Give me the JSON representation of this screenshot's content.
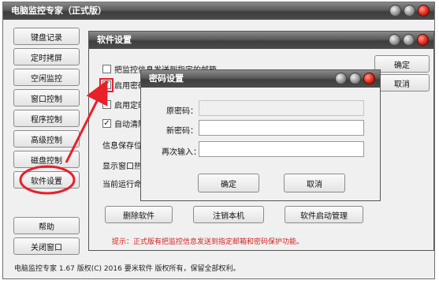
{
  "main_window": {
    "title": "电脑监控专家（正式版）",
    "menu": [
      "键盘记录",
      "定时拷屏",
      "空闲监控",
      "窗口控制",
      "程序控制",
      "高级控制",
      "磁盘控制",
      "软件设置"
    ],
    "help_label": "帮助",
    "close_label": "关闭窗口",
    "status_text": "电脑监控专家 1.67 版权(C) 2016 要米软件 版权所有，保留全部权利。"
  },
  "settings_window": {
    "title": "软件设置",
    "options": [
      {
        "label": "把监控信息发送到指定的邮箱",
        "checked": false
      },
      {
        "label": "启用密码",
        "checked": true
      },
      {
        "label": "启用定时",
        "checked": false
      },
      {
        "label": "自动清除",
        "checked": true
      }
    ],
    "info_save_label": "信息保存位置",
    "hotkey_label": "显示窗口热键",
    "current_label": "当前运行命令",
    "ok_label": "确定",
    "cancel_label": "取消",
    "uninstall_label": "删除软件",
    "logout_label": "注销本机",
    "startup_label": "软件启动管理",
    "hint_text": "提示：正式版有把监控信息发送到指定邮箱和密码保护功能。"
  },
  "password_dialog": {
    "title": "密码设置",
    "old_password_label": "原密码：",
    "new_password_label": "新密码：",
    "confirm_label": "再次输入：",
    "old_password_value": "",
    "new_password_value": "",
    "confirm_value": "",
    "ok_label": "确定",
    "cancel_label": "取消"
  },
  "colors": {
    "titlebar": "#4c4c4c",
    "window_bg": "#f0f0f0",
    "highlight": "#e8202a",
    "hint_text": "#d2231d"
  }
}
